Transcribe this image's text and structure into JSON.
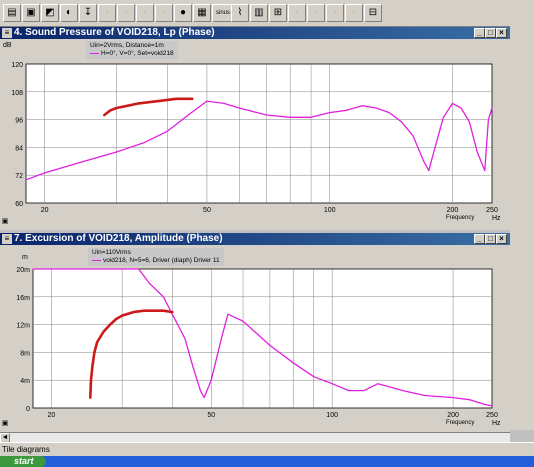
{
  "toolbar": {
    "buttons": [
      "save-icon",
      "floppy-icon",
      "chart-icon",
      "driver-icon",
      "import-icon",
      "disabled1",
      "disabled2",
      "disabled3",
      "disabled4",
      "record-icon",
      "photo-icon",
      "sinus-icon",
      "plot-icon",
      "grid-icon",
      "zoom-icon",
      "disabled5",
      "disabled6",
      "disabled7",
      "disabled8",
      "grid2-icon"
    ],
    "sinus_label": "sinus"
  },
  "window1": {
    "title": "4. Sound Pressure of VOID218, Lp (Phase)",
    "y_unit": "dB",
    "legend_line1": "Uin=2Vrms, Distance=1m",
    "legend_line2": "H=0°, V=0°, Set=void218",
    "x_unit": "Hz",
    "x_axis_label": "Frequency"
  },
  "window2": {
    "title": "7. Excursion of VOID218, Amplitude (Phase)",
    "y_unit": "m",
    "legend_line1": "Uin=110Vrms",
    "legend_line2": "void218, N=5=6, Driver (diaph) Driver 11",
    "x_unit": "Hz",
    "x_axis_label": "Frequency"
  },
  "window_buttons": {
    "minimize": "_",
    "maximize": "□",
    "close": "×"
  },
  "statusbar": {
    "text": "Tile diagrams"
  },
  "taskbar": {
    "start": "start"
  },
  "colors": {
    "curve": "#e020e0",
    "markup": "#cc1a1a",
    "titlebar": "#0a246a",
    "plot_bg": "#ffffff",
    "grid": "#808080"
  },
  "chart_data": [
    {
      "type": "line",
      "title": "4. Sound Pressure of VOID218, Lp (Phase)",
      "xlabel": "Frequency",
      "x_unit": "Hz",
      "ylabel": "dB",
      "x_scale": "log",
      "xlim": [
        18,
        250
      ],
      "ylim": [
        60,
        120
      ],
      "x_ticks": [
        "20",
        "50",
        "100",
        "200",
        "250"
      ],
      "y_ticks": [
        "60",
        "72",
        "84",
        "96",
        "108",
        "120"
      ],
      "series": [
        {
          "name": "H=0°, V=0°, Set=void218",
          "color": "#e020e0",
          "x": [
            18,
            20,
            25,
            30,
            35,
            40,
            45,
            50,
            55,
            60,
            70,
            80,
            90,
            100,
            110,
            120,
            130,
            140,
            150,
            160,
            170,
            175,
            180,
            190,
            200,
            210,
            220,
            230,
            240,
            245,
            250
          ],
          "y": [
            70,
            73,
            78,
            82,
            86,
            91,
            98,
            104,
            103,
            101,
            98,
            97,
            97,
            99,
            100,
            102,
            101,
            99,
            95,
            89,
            78,
            74,
            82,
            97,
            103,
            101,
            95,
            82,
            74,
            96,
            101
          ]
        },
        {
          "name": "",
          "color": "#cc1a1a",
          "x": [
            28,
            29,
            30,
            32,
            34,
            36,
            38,
            40,
            42,
            44,
            46
          ],
          "y": [
            98,
            100,
            101,
            102,
            103,
            103.5,
            104,
            104.5,
            105,
            105,
            105
          ]
        }
      ]
    },
    {
      "type": "line",
      "title": "7. Excursion of VOID218, Amplitude (Phase)",
      "xlabel": "Frequency",
      "x_unit": "Hz",
      "ylabel": "m",
      "x_scale": "log",
      "xlim": [
        18,
        250
      ],
      "ylim": [
        0,
        20
      ],
      "x_ticks": [
        "20",
        "50",
        "100",
        "200",
        "250"
      ],
      "y_ticks": [
        "0",
        "4m",
        "8m",
        "12m",
        "16m",
        "20m"
      ],
      "series": [
        {
          "name": "void218, N=5=6, Driver (diaph) Driver 11",
          "color": "#e020e0",
          "x": [
            18,
            20,
            25,
            30,
            33,
            35,
            38,
            40,
            43,
            45,
            47,
            48,
            50,
            53,
            55,
            60,
            70,
            80,
            90,
            100,
            110,
            120,
            130,
            140,
            150,
            170,
            200,
            220,
            240,
            250
          ],
          "y": [
            20,
            20,
            20,
            20,
            20,
            18,
            16,
            13.5,
            10,
            6,
            2.5,
            1.5,
            4,
            10,
            13.5,
            12.5,
            9,
            6.5,
            4.5,
            3.5,
            2.5,
            2.5,
            3.5,
            3,
            2.5,
            1.8,
            1.5,
            1.2,
            0.5,
            0.3
          ],
          "role": "excursion"
        },
        {
          "name": "",
          "color": "#cc1a1a",
          "x": [
            25,
            25.1,
            25.3,
            25.6,
            26,
            27,
            28,
            29,
            30,
            32,
            34,
            36,
            38,
            40
          ],
          "y": [
            1.5,
            4,
            6,
            8,
            9.5,
            11,
            12,
            12.8,
            13.3,
            13.8,
            14,
            14,
            14,
            13.8
          ]
        }
      ]
    }
  ]
}
